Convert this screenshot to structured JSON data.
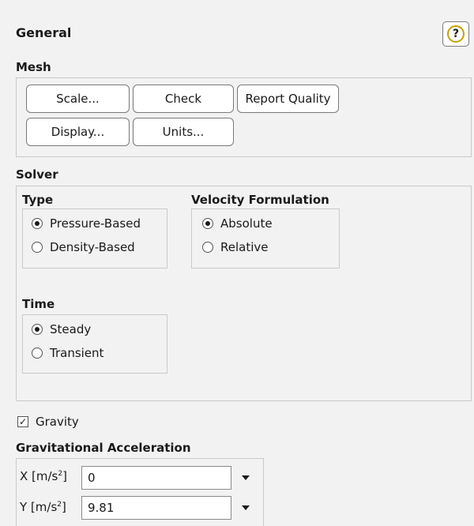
{
  "header": {
    "title": "General",
    "help_icon": "help-icon",
    "help_glyph": "?"
  },
  "mesh": {
    "title": "Mesh",
    "buttons": {
      "scale": "Scale...",
      "check": "Check",
      "report_quality": "Report Quality",
      "display": "Display...",
      "units": "Units..."
    }
  },
  "solver": {
    "title": "Solver",
    "type": {
      "title": "Type",
      "options": [
        "Pressure-Based",
        "Density-Based"
      ],
      "selected": "Pressure-Based"
    },
    "velocity": {
      "title": "Velocity Formulation",
      "options": [
        "Absolute",
        "Relative"
      ],
      "selected": "Absolute"
    },
    "time": {
      "title": "Time",
      "options": [
        "Steady",
        "Transient"
      ],
      "selected": "Steady"
    }
  },
  "gravity": {
    "label": "Gravity",
    "checked": true,
    "check_glyph": "✓"
  },
  "gravitational_acceleration": {
    "title": "Gravitational Acceleration",
    "x_label_prefix": "X [m/s",
    "x_label_suffix": "]",
    "x_value": "0",
    "y_label_prefix": "Y [m/s",
    "y_label_suffix": "]",
    "y_value": "9.81",
    "unit_exponent": "2"
  },
  "colors": {
    "panel_bg": "#f2f2f2",
    "border": "#c9c9c9",
    "help_ring": "#c9a100"
  }
}
